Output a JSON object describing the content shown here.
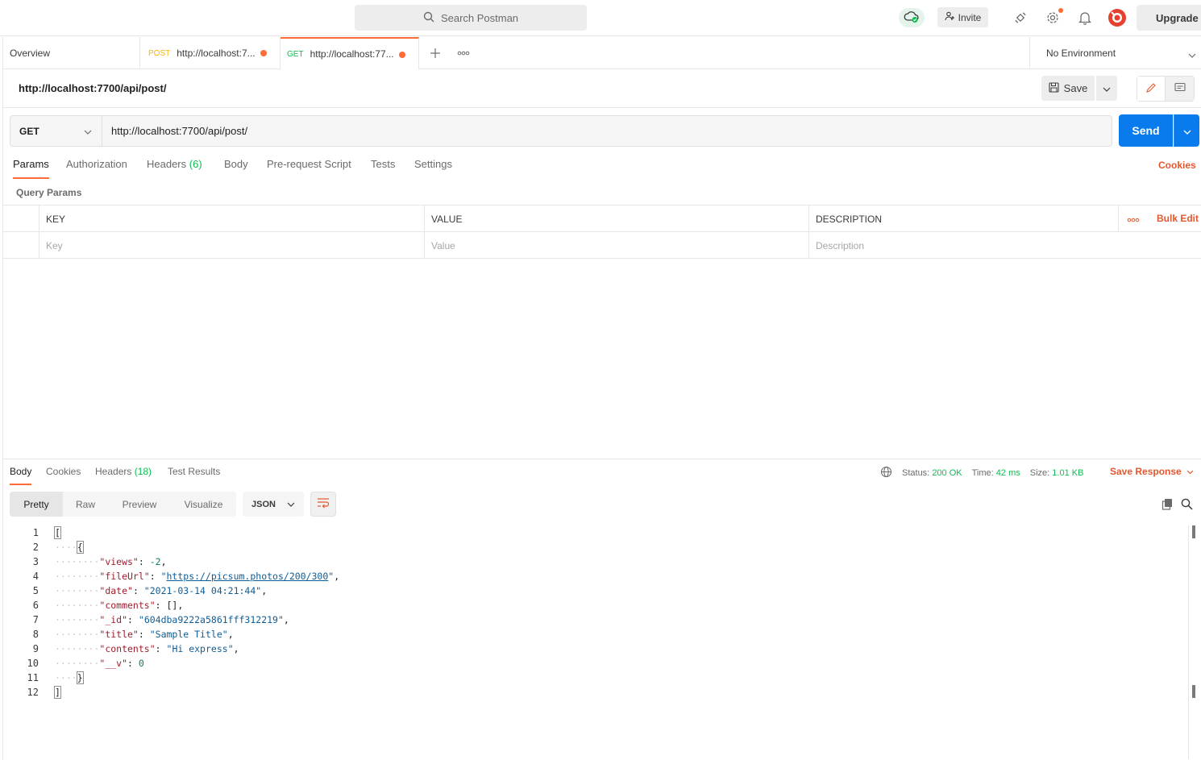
{
  "header": {
    "search_placeholder": "Search Postman",
    "invite_label": "Invite",
    "upgrade_label": "Upgrade"
  },
  "tabs": [
    {
      "label": "Overview",
      "method": ""
    },
    {
      "label": "http://localhost:7...",
      "method": "POST",
      "method_color": "#ffb400"
    },
    {
      "label": "http://localhost:77...",
      "method": "GET",
      "method_color": "#0cbb52"
    }
  ],
  "environment": {
    "selected": "No Environment"
  },
  "request": {
    "title": "http://localhost:7700/api/post/",
    "save_label": "Save",
    "method": "GET",
    "url": "http://localhost:7700/api/post/",
    "send_label": "Send"
  },
  "request_tabs": [
    {
      "label": "Params",
      "count": ""
    },
    {
      "label": "Authorization",
      "count": ""
    },
    {
      "label": "Headers",
      "count": "(6)"
    },
    {
      "label": "Body",
      "count": ""
    },
    {
      "label": "Pre-request Script",
      "count": ""
    },
    {
      "label": "Tests",
      "count": ""
    },
    {
      "label": "Settings",
      "count": ""
    }
  ],
  "cookies_label": "Cookies",
  "query_params": {
    "label": "Query Params",
    "columns": [
      "KEY",
      "VALUE",
      "DESCRIPTION"
    ],
    "placeholders": {
      "key": "Key",
      "value": "Value",
      "description": "Description"
    },
    "bulk_edit_label": "Bulk Edit"
  },
  "response": {
    "tabs": [
      {
        "label": "Body",
        "count": ""
      },
      {
        "label": "Cookies",
        "count": ""
      },
      {
        "label": "Headers",
        "count": "(18)"
      },
      {
        "label": "Test Results",
        "count": ""
      }
    ],
    "status_label": "Status:",
    "status_value": "200 OK",
    "time_label": "Time:",
    "time_value": "42 ms",
    "size_label": "Size:",
    "size_value": "1.01 KB",
    "save_response_label": "Save Response",
    "view_modes": [
      "Pretty",
      "Raw",
      "Preview",
      "Visualize"
    ],
    "format": "JSON",
    "line_numbers": [
      "1",
      "2",
      "3",
      "4",
      "5",
      "6",
      "7",
      "8",
      "9",
      "10",
      "11",
      "12"
    ],
    "body": {
      "views": "-2",
      "fileUrl": "https://picsum.photos/200/300",
      "date": "2021-03-14 04:21:44",
      "comments": "[]",
      "_id": "604dba9222a5861fff312219",
      "title": "Sample Title",
      "contents": "Hi express",
      "__v": "0"
    }
  }
}
